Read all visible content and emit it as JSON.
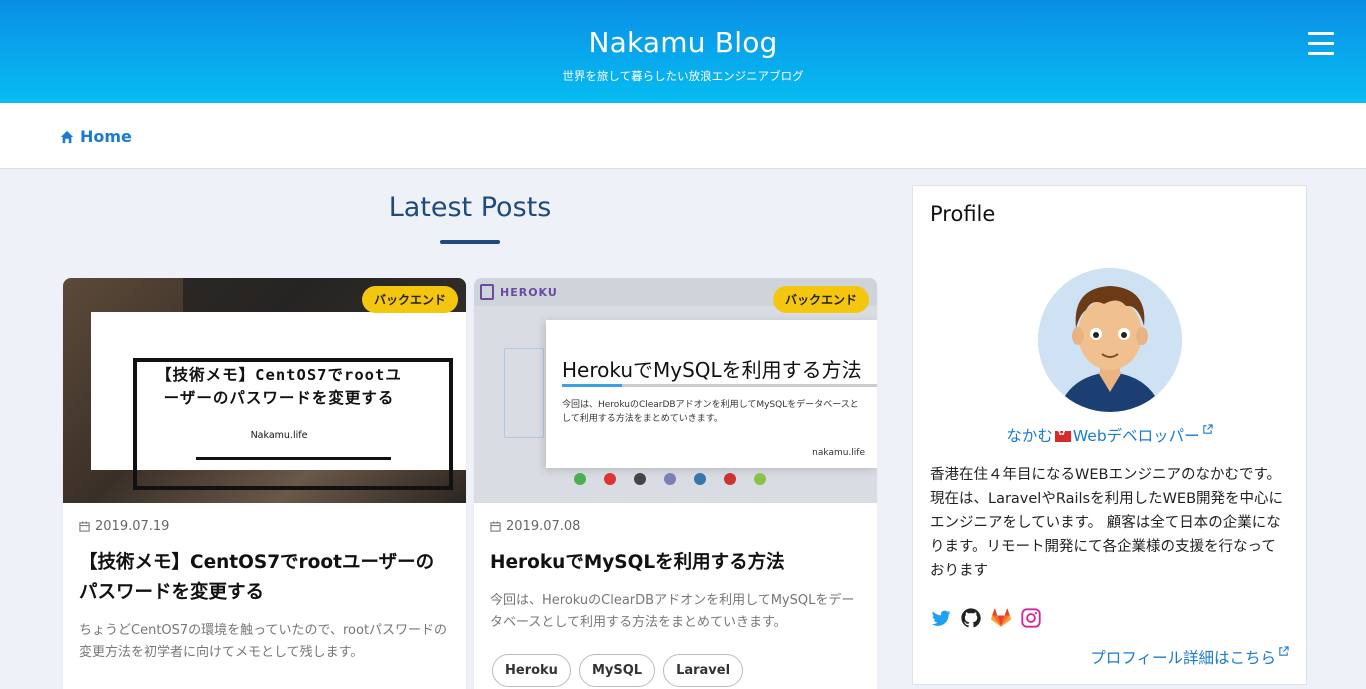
{
  "header": {
    "title": "Nakamu Blog",
    "subtitle": "世界を旅して暮らしたい放浪エンジニアブログ",
    "menu_icon": "hamburger-icon"
  },
  "breadcrumb": {
    "home_label": "Home",
    "icon": "home-icon"
  },
  "latest": {
    "heading": "Latest Posts"
  },
  "posts": [
    {
      "category": "バックエンド",
      "date": "2019.07.19",
      "title": "【技術メモ】CentOS7でrootユーザーのパスワードを変更する",
      "excerpt": "ちょうどCentOS7の環境を触っていたので、rootパスワードの変更方法を初学者に向けてメモとして残します。",
      "thumb_text_1": "【技術メモ】CentOS7でrootユ",
      "thumb_text_2": "ーザーのパスワードを変更する",
      "thumb_sign": "Nakamu.life",
      "tags": []
    },
    {
      "category": "バックエンド",
      "date": "2019.07.08",
      "title": "HerokuでMySQLを利用する方法",
      "excerpt": "今回は、HerokuのClearDBアドオンを利用してMySQLをデータベースとして利用する方法をまとめていきます。",
      "thumb_logo": "HEROKU",
      "thumb_title": "HerokuでMySQLを利用する方法",
      "thumb_desc": "今回は、HerokuのClearDBアドオンを利用してMySQLをデータベースとして利用する方法をまとめていきます。",
      "thumb_sign": "nakamu.life",
      "tags": [
        "Heroku",
        "MySQL",
        "Laravel"
      ]
    }
  ],
  "profile": {
    "title": "Profile",
    "name_part1": "なかむ",
    "name_part2": "Webデベロッパー",
    "bio": "香港在住４年目になるWEBエンジニアのなかむです。 現在は、LaravelやRailsを利用したWEB開発を中心にエンジニアをしています。 顧客は全て日本の企業になります。リモート開発にて各企業様の支援を行なっております",
    "more_link": "プロフィール詳細はこちら",
    "socials": [
      "twitter-icon",
      "github-icon",
      "gitlab-icon",
      "instagram-icon"
    ]
  },
  "colors": {
    "header_top": "#0b8ee6",
    "header_bottom": "#06bdf1",
    "link": "#1a7bd0",
    "heading": "#1e4a7e",
    "badge": "#f4c70e"
  }
}
